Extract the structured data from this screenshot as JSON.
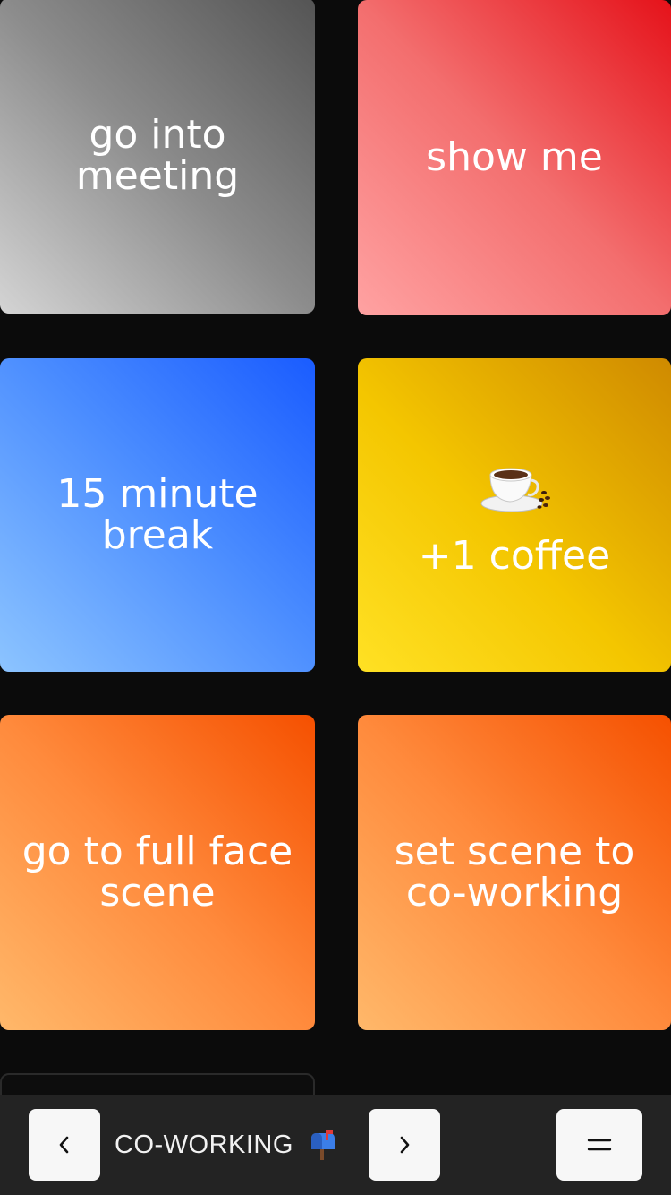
{
  "tiles": [
    {
      "label": "go into meeting"
    },
    {
      "label": "show me"
    },
    {
      "label": "15 minute break"
    },
    {
      "label": "+1 coffee",
      "icon": "coffee-cup-icon"
    },
    {
      "label": "go to full face scene"
    },
    {
      "label": "set scene to co-working"
    },
    {
      "label": ""
    }
  ],
  "bottom_bar": {
    "prev_icon": "chevron-left-icon",
    "scene_name": "CO-WORKING",
    "scene_icon": "mailbox-icon",
    "next_icon": "chevron-right-icon",
    "menu_icon": "menu-icon"
  },
  "colors": {
    "background": "#0b0b0b",
    "bar": "#232323",
    "button": "#f7f7f7"
  }
}
